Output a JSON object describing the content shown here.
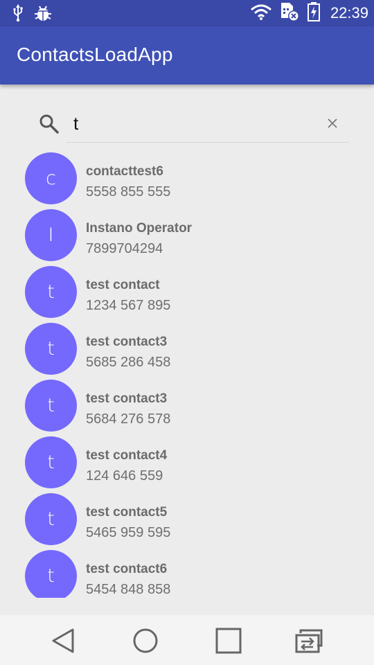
{
  "status_bar": {
    "time": "22:39",
    "left_icons": [
      "usb-icon",
      "android-debug-icon"
    ],
    "right_icons": [
      "wifi-icon",
      "sim-blocked-icon",
      "battery-charging-icon"
    ]
  },
  "app_bar": {
    "title": "ContactsLoadApp"
  },
  "search": {
    "value": "t",
    "icon": "search-icon",
    "clear_icon": "close-icon"
  },
  "contacts": [
    {
      "initial": "c",
      "name": "contacttest6",
      "phone": "5558 855 555"
    },
    {
      "initial": "I",
      "name": "Instano Operator",
      "phone": "7899704294"
    },
    {
      "initial": "t",
      "name": "test contact",
      "phone": "1234 567 895"
    },
    {
      "initial": "t",
      "name": "test contact3",
      "phone": "5685 286 458"
    },
    {
      "initial": "t",
      "name": "test contact3",
      "phone": "5684 276 578"
    },
    {
      "initial": "t",
      "name": "test contact4",
      "phone": "124 646 559"
    },
    {
      "initial": "t",
      "name": "test contact5",
      "phone": "5465 959 595"
    },
    {
      "initial": "t",
      "name": "test contact6",
      "phone": "5454 848 858"
    }
  ],
  "nav_bar": {
    "buttons": [
      "back-icon",
      "home-icon",
      "recents-icon",
      "switch-app-icon"
    ]
  },
  "colors": {
    "status_bar": "#3a49a8",
    "app_bar": "#3f51b5",
    "avatar": "#7469fc",
    "background": "#ececec"
  }
}
